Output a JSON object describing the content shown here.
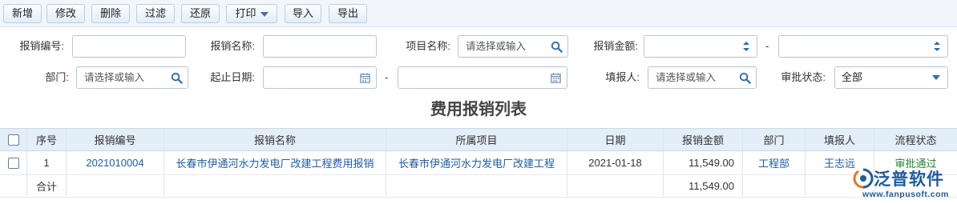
{
  "toolbar": {
    "new": "新增",
    "edit": "修改",
    "delete": "删除",
    "filter": "过滤",
    "restore": "还原",
    "print": "打印",
    "import": "导入",
    "export": "导出"
  },
  "filters": {
    "code_label": "报销编号:",
    "name_label": "报销名称:",
    "project_label": "项目名称:",
    "project_placeholder": "请选择或输入",
    "amount_label": "报销金额:",
    "range_dash": "-",
    "dept_label": "部门:",
    "dept_placeholder": "请选择或输入",
    "date_label": "起止日期:",
    "date_dash": "-",
    "filler_label": "填报人:",
    "filler_placeholder": "请选择或输入",
    "status_label": "审批状态:",
    "status_value": "全部"
  },
  "list_title": "费用报销列表",
  "table": {
    "columns": [
      "序号",
      "报销编号",
      "报销名称",
      "所属项目",
      "日期",
      "报销金额",
      "部门",
      "填报人",
      "流程状态"
    ],
    "rows": [
      {
        "index": "1",
        "code": "2021010004",
        "name": "长春市伊通河水力发电厂改建工程费用报销",
        "project": "长春市伊通河水力发电厂改建工程",
        "date": "2021-01-18",
        "amount": "11,549.00",
        "dept": "工程部",
        "filler": "王志远",
        "status": "审批通过"
      }
    ],
    "total_label": "合计",
    "total_amount": "11,549.00"
  },
  "logo": {
    "brand": "泛普软件",
    "url": "www.fanpusoft.com"
  },
  "colors": {
    "link": "#1d5fa8",
    "status_ok": "#1b8a2a",
    "header_bg": "#e3eef9",
    "brand": "#1f5a9e"
  }
}
